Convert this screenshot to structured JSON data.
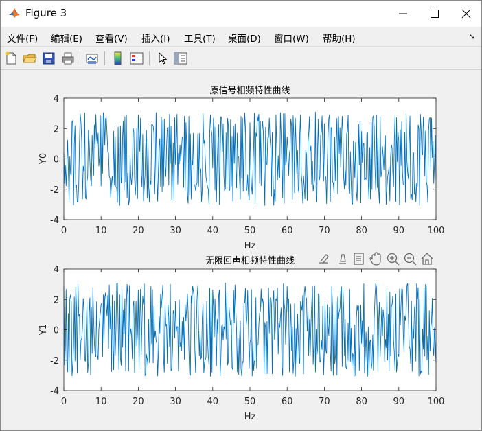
{
  "window": {
    "title": "Figure 3"
  },
  "menu": [
    {
      "label": "文件(F)"
    },
    {
      "label": "编辑(E)"
    },
    {
      "label": "查看(V)"
    },
    {
      "label": "插入(I)"
    },
    {
      "label": "工具(T)"
    },
    {
      "label": "桌面(D)"
    },
    {
      "label": "窗口(W)"
    },
    {
      "label": "帮助(H)"
    }
  ],
  "toolbar": [
    {
      "icon": "new-figure-icon"
    },
    {
      "icon": "open-file-icon"
    },
    {
      "icon": "save-icon"
    },
    {
      "icon": "print-icon"
    },
    {
      "icon": "link-plot-icon"
    },
    {
      "icon": "colorbar-icon"
    },
    {
      "icon": "legend-icon"
    },
    {
      "icon": "pointer-icon"
    },
    {
      "icon": "property-inspector-icon"
    }
  ],
  "axes_toolbar": [
    "brush-icon",
    "data-cursor-icon",
    "brush-data-icon",
    "pan-icon",
    "zoom-in-icon",
    "zoom-out-icon",
    "home-icon"
  ],
  "colors": {
    "line": "#0072bd",
    "axes_bg": "#ffffff",
    "figure_bg": "#f0f0f0"
  },
  "chart_data": [
    {
      "type": "line",
      "title": "原信号相频特性曲线",
      "xlabel": "Hz",
      "ylabel": "Y0",
      "xlim": [
        0,
        100
      ],
      "ylim": [
        -4,
        4
      ],
      "xticks": [
        "0",
        "10",
        "20",
        "30",
        "40",
        "50",
        "60",
        "70",
        "80",
        "90",
        "100"
      ],
      "yticks": [
        "4",
        "2",
        "0",
        "-2",
        "-4"
      ],
      "grid": false,
      "series": [
        {
          "samples": 500,
          "value_range": [
            -3.1,
            3.1
          ]
        }
      ]
    },
    {
      "type": "line",
      "title": "无限回声相频特性曲线",
      "xlabel": "Hz",
      "ylabel": "Y1",
      "xlim": [
        0,
        100
      ],
      "ylim": [
        -4,
        4
      ],
      "xticks": [
        "0",
        "10",
        "20",
        "30",
        "40",
        "50",
        "60",
        "70",
        "80",
        "90",
        "100"
      ],
      "yticks": [
        "4",
        "2",
        "0",
        "-2",
        "-4"
      ],
      "grid": false,
      "series": [
        {
          "samples": 500,
          "value_range": [
            -3.1,
            3.1
          ]
        }
      ]
    }
  ]
}
